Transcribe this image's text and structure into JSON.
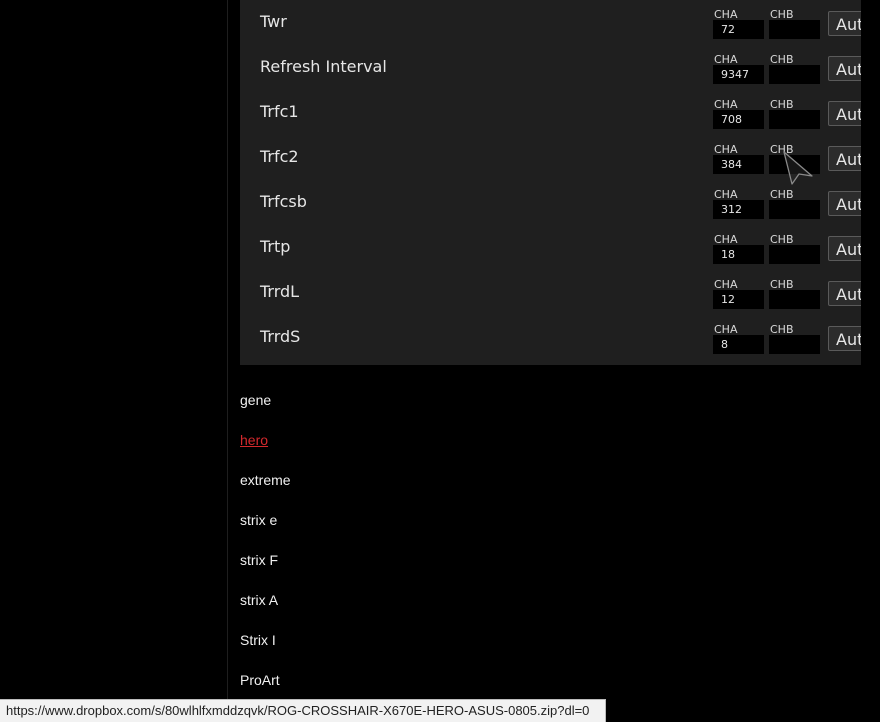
{
  "timings": {
    "channel_a_label": "CHA",
    "channel_b_label": "CHB",
    "auto_label": "Auto",
    "rows": [
      {
        "name": "Twr",
        "cha": "72",
        "chb": ""
      },
      {
        "name": "Refresh Interval",
        "cha": "9347",
        "chb": ""
      },
      {
        "name": "Trfc1",
        "cha": "708",
        "chb": ""
      },
      {
        "name": "Trfc2",
        "cha": "384",
        "chb": ""
      },
      {
        "name": "Trfcsb",
        "cha": "312",
        "chb": ""
      },
      {
        "name": "Trtp",
        "cha": "18",
        "chb": ""
      },
      {
        "name": "TrrdL",
        "cha": "12",
        "chb": ""
      },
      {
        "name": "TrrdS",
        "cha": "8",
        "chb": ""
      }
    ]
  },
  "links": [
    {
      "label": "gene",
      "active": false
    },
    {
      "label": "hero",
      "active": true
    },
    {
      "label": "extreme",
      "active": false
    },
    {
      "label": "strix e",
      "active": false
    },
    {
      "label": "strix F",
      "active": false
    },
    {
      "label": "strix A",
      "active": false
    },
    {
      "label": "Strix I",
      "active": false
    },
    {
      "label": "ProArt",
      "active": false
    }
  ],
  "status_bar": {
    "url": "https://www.dropbox.com/s/80wlhlfxmddzqvk/ROG-CROSSHAIR-X670E-HERO-ASUS-0805.zip?dl=0"
  },
  "colors": {
    "background": "#000000",
    "panel": "#1f1f1f",
    "active_link": "#d4292d"
  },
  "icons": {
    "cursor": "mouse-pointer-icon"
  }
}
